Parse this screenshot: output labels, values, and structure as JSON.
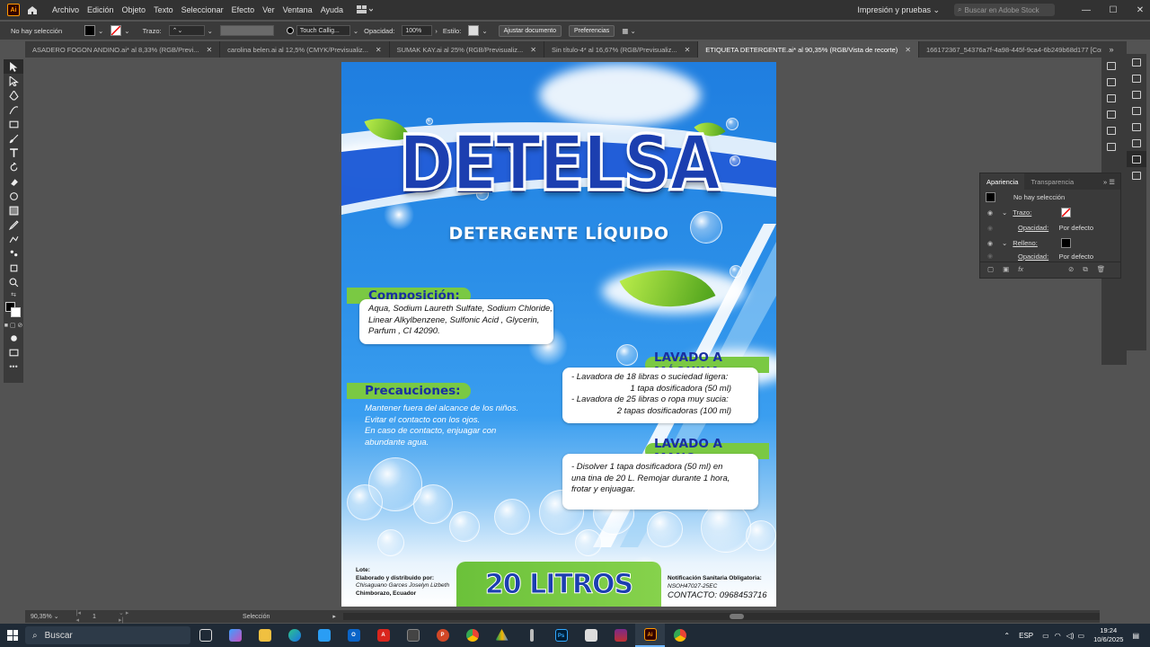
{
  "menubar": {
    "app_icon": "Ai",
    "items": [
      "Archivo",
      "Edición",
      "Objeto",
      "Texto",
      "Seleccionar",
      "Efecto",
      "Ver",
      "Ventana",
      "Ayuda"
    ],
    "workspace": "Impresión y pruebas",
    "stock_search_placeholder": "Buscar en Adobe Stock"
  },
  "controlbar": {
    "selection_status": "No hay selección",
    "stroke_label": "Trazo:",
    "brush": "Touch Callig...",
    "opacity_label": "Opacidad:",
    "opacity_value": "100%",
    "style_label": "Estilo:",
    "fit_button": "Ajustar documento",
    "prefs_button": "Preferencias"
  },
  "tabs": [
    {
      "label": "ASADERO FOGON ANDINO.ai* al 8,33% (RGB/Previ...",
      "active": false
    },
    {
      "label": "carolina belen.ai al 12,5% (CMYK/Previsualiz...",
      "active": false
    },
    {
      "label": "SUMAK KAY.ai al 25% (RGB/Previsualiz...",
      "active": false
    },
    {
      "label": "Sin título-4* al 16,67% (RGB/Previsualiz...",
      "active": false
    },
    {
      "label": "ETIQUETA DETERGENTE.ai* al 90,35% (RGB/Vista de recorte)",
      "active": true
    },
    {
      "label": "166172367_54376a7f-4a98-445f-9ca4-6b249b68d177 [Conve",
      "active": false
    }
  ],
  "appearance_panel": {
    "tab_active": "Apariencia",
    "tab_other": "Transparencia",
    "no_selection": "No hay selección",
    "stroke_label": "Trazo:",
    "opacity_label": "Opacidad:",
    "opacity_value": "Por defecto",
    "fill_label": "Relleno:",
    "opacity_label_2": "Opacidad:",
    "opacity_value_2": "Por defecto"
  },
  "artwork": {
    "brand": "DETELSA",
    "subtitle": "DETERGENTE LÍQUIDO",
    "composicion_title": "Composición:",
    "composicion_lines": [
      "Aqua, Sodium Laureth Sulfate, Sodium Chloride,",
      "Linear Alkylbenzene, Sulfonic Acid , Glycerin,",
      "Parfum , CI 42090."
    ],
    "precauciones_title": "Precauciones:",
    "precauciones_lines": [
      "Mantener fuera del alcance de los niños.",
      "Evitar el contacto con los ojos.",
      "En caso de contacto, enjuagar con",
      "abundante agua."
    ],
    "maquina_title": "LAVADO A MÁQUINA:",
    "maquina_lines": [
      "- Lavadora de 18 libras o suciedad ligera:",
      "1 tapa dosificadora (50 ml)",
      "- Lavadora de 25 libras o ropa muy sucia:",
      "2 tapas dosificadoras (100 ml)"
    ],
    "mano_title": "LAVADO A MANO:",
    "mano_lines": [
      "- Disolver 1 tapa dosificadora (50 ml) en",
      "una tina de 20 L. Remojar durante 1 hora,",
      "frotar y enjuagar."
    ],
    "volume": "20 LITROS",
    "lote_label": "Lote:",
    "made_by_label": "Elaborado y distribuido por:",
    "maker_name": "Chisaguano Garces Joselyn Lizbeth",
    "location": "Chimborazo, Ecuador",
    "notification_label": "Notificación Sanitaria Obligatoria:",
    "notification_code": "NSOH47027-25EC",
    "contact": "CONTACTO: 0968453716"
  },
  "statusbar": {
    "zoom": "90,35%",
    "artboard_num": "1",
    "mode": "Selección"
  },
  "taskbar": {
    "search_placeholder": "Buscar",
    "language": "ESP",
    "time": "19:24",
    "date": "10/6/2025"
  },
  "colors": {
    "brand_blue": "#1c3fb0",
    "accent_green": "#7ac943",
    "ui_dark": "#323232"
  }
}
